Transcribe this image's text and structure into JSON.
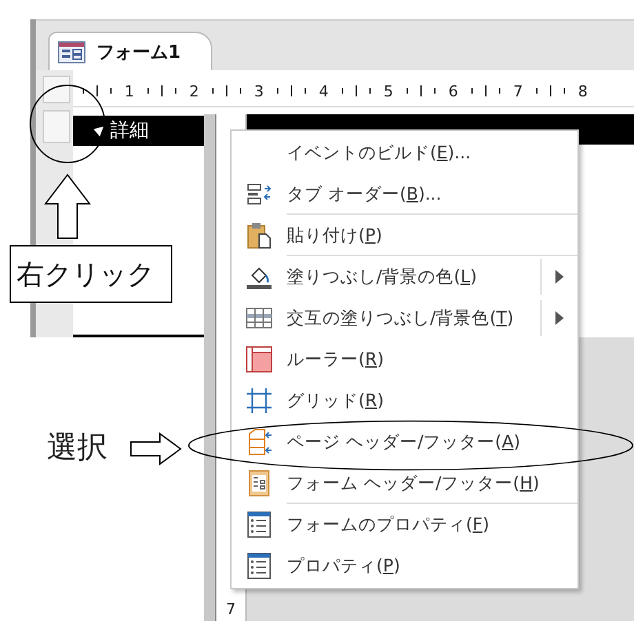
{
  "document_tab": {
    "title": "フォーム1",
    "selected": true
  },
  "ruler": {
    "marks": [
      "1",
      "2",
      "3",
      "4",
      "5",
      "6",
      "7",
      "8"
    ]
  },
  "detail_section": {
    "label": "詳細"
  },
  "back_window": {
    "ruler_mark": "7"
  },
  "context_menu": {
    "items": [
      {
        "label": "イベントのビルド(",
        "key": "E",
        "suffix": ")...",
        "submenu": false,
        "separator_after": false
      },
      {
        "label": "タブ オーダー(",
        "key": "B",
        "suffix": ")...",
        "submenu": false,
        "separator_after": true
      },
      {
        "label": "貼り付け(",
        "key": "P",
        "suffix": ")",
        "submenu": false,
        "separator_after": true
      },
      {
        "label": "塗りつぶし/背景の色(",
        "key": "L",
        "suffix": ")",
        "submenu": true,
        "separator_after": false
      },
      {
        "label": "交互の塗りつぶし/背景色(",
        "key": "T",
        "suffix": ")",
        "submenu": true,
        "separator_after": false
      },
      {
        "label": "ルーラー(",
        "key": "R",
        "suffix": ")",
        "submenu": false,
        "separator_after": false
      },
      {
        "label": "グリッド(",
        "key": "R",
        "suffix": ")",
        "submenu": false,
        "separator_after": false
      },
      {
        "label": "ページ ヘッダー/フッター(",
        "key": "A",
        "suffix": ")",
        "submenu": false,
        "separator_after": false
      },
      {
        "label": "フォーム ヘッダー/フッター(",
        "key": "H",
        "suffix": ")",
        "submenu": false,
        "separator_after": true
      },
      {
        "label": "フォームのプロパティ(",
        "key": "F",
        "suffix": ")",
        "submenu": false,
        "separator_after": false
      },
      {
        "label": "プロパティ(",
        "key": "P",
        "suffix": ")",
        "submenu": false,
        "separator_after": false
      }
    ]
  },
  "callouts": {
    "right_click": "右クリック",
    "select": "選択"
  }
}
